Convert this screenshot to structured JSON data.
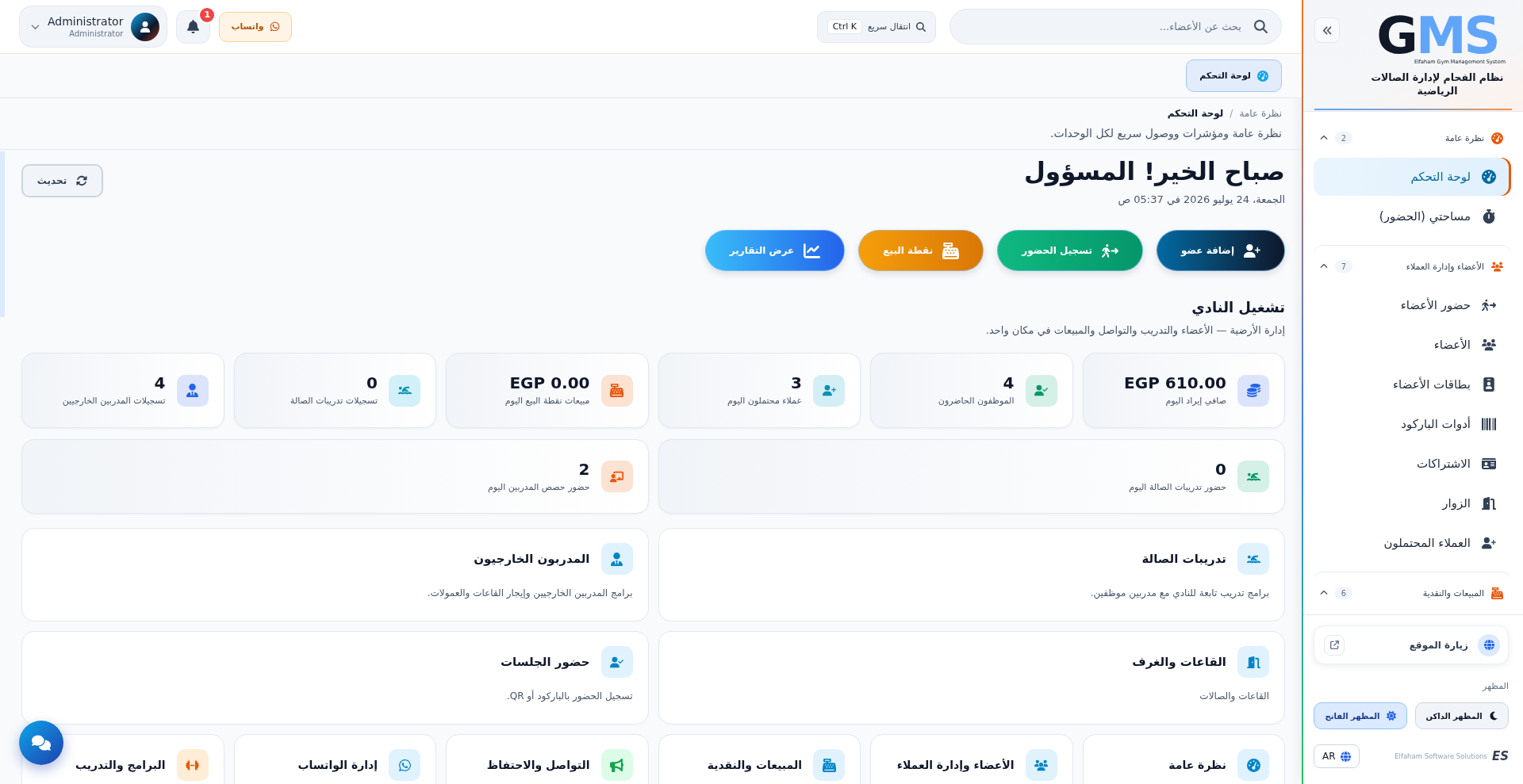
{
  "header": {
    "search": {
      "placeholder": "بحث عن الأعضاء..."
    },
    "quick_nav": {
      "label": "انتقال سريع",
      "shortcut": "Ctrl K"
    },
    "whatsapp": {
      "label": "واتساب"
    },
    "notifications": {
      "count": "1"
    },
    "user": {
      "name": "Administrator",
      "role": "Administrator"
    }
  },
  "tabs": [
    {
      "label": "لوحة التحكم",
      "selected": true
    }
  ],
  "breadcrumb": {
    "separator": "/",
    "items": [
      {
        "label": "نظرة عامة",
        "current": false
      },
      {
        "label": "لوحة التحكم",
        "current": true
      }
    ]
  },
  "page_description": "نظرة عامة ومؤشرات ووصول سريع لكل الوحدات.",
  "greeting": {
    "title": "صباح الخير! المسؤول",
    "date": "الجمعة، 24 يوليو 2026 في 05:37 ص",
    "refresh_button": "تحديث"
  },
  "quick_actions": [
    {
      "label": "إضافة عضو",
      "kind": "member"
    },
    {
      "label": "تسجيل الحضور",
      "kind": "attendance"
    },
    {
      "label": "نقطة البيع",
      "kind": "pos"
    },
    {
      "label": "عرض التقارير",
      "kind": "reports"
    }
  ],
  "section": {
    "title": "تشغيل النادي",
    "subtitle": "إدارة الأرضية — الأعضاء والتدريب والتواصل والمبيعات في مكان واحد."
  },
  "stats": [
    {
      "value": "EGP 610.00",
      "label": "صافي إيراد اليوم",
      "kind": "revenue"
    },
    {
      "value": "4",
      "label": "الموظفون الحاضرون",
      "kind": "staff"
    },
    {
      "value": "3",
      "label": "عملاء محتملون اليوم",
      "kind": "leads"
    },
    {
      "value": "EGP 0.00",
      "label": "مبيعات نقطة البيع اليوم",
      "kind": "pos"
    },
    {
      "value": "0",
      "label": "تسجيلات تدريبات الصالة",
      "kind": "gym"
    },
    {
      "value": "4",
      "label": "تسجيلات المدربين الخارجيين",
      "kind": "trainers"
    }
  ],
  "attendance_stats": [
    {
      "value": "0",
      "label": "حضور تدريبات الصالة اليوم",
      "kind": "gym"
    },
    {
      "value": "2",
      "label": "حضور حصص المدربين اليوم",
      "kind": "classes"
    }
  ],
  "modules": [
    {
      "title": "تدريبات الصالة",
      "description": "برامج تدريب تابعة للنادي مع مدربين موظفين.",
      "kind": "gym"
    },
    {
      "title": "المدربون الخارجيون",
      "description": "برامج المدربين الخارجيين وإيجار القاعات والعمولات.",
      "kind": "trainers"
    },
    {
      "title": "القاعات والغرف",
      "description": "القاعات والصالات",
      "kind": "rooms"
    },
    {
      "title": "حضور الجلسات",
      "description": "تسجيل الحضور بالباركود أو QR.",
      "kind": "sessions"
    }
  ],
  "hub_cards": [
    {
      "title": "نظرة عامة",
      "kind": "overview"
    },
    {
      "title": "الأعضاء وإدارة العملاء",
      "kind": "members"
    },
    {
      "title": "المبيعات والنقدية",
      "kind": "sales"
    },
    {
      "title": "التواصل والاحتفاظ",
      "kind": "retention"
    },
    {
      "title": "إدارة الواتساب",
      "kind": "whatsapp"
    },
    {
      "title": "البرامج والتدريب",
      "kind": "programs"
    }
  ],
  "sidebar": {
    "logo": {
      "primary": "G",
      "accent": "MS",
      "tagline": "Elfaham Gym Management System"
    },
    "title": "نظام الفحام لإدارة الصالات الرياضية",
    "groups": [
      {
        "label": "نظرة عامة",
        "count": "2",
        "expanded": true,
        "kind": "overview",
        "items": [
          {
            "label": "لوحة التحكم",
            "kind": "dashboard",
            "selected": true
          },
          {
            "label": "مساحتي (الحضور)",
            "kind": "myspace",
            "selected": false
          }
        ]
      },
      {
        "label": "الأعضاء وإدارة العملاء",
        "count": "7",
        "expanded": true,
        "kind": "members",
        "items": [
          {
            "label": "حضور الأعضاء",
            "kind": "attendance",
            "selected": false
          },
          {
            "label": "الأعضاء",
            "kind": "members",
            "selected": false
          },
          {
            "label": "بطاقات الأعضاء",
            "kind": "cards",
            "selected": false
          },
          {
            "label": "أدوات الباركود",
            "kind": "barcode",
            "selected": false
          },
          {
            "label": "الاشتراكات",
            "kind": "subscriptions",
            "selected": false
          },
          {
            "label": "الزوار",
            "kind": "visitors",
            "selected": false
          },
          {
            "label": "العملاء المحتملون",
            "kind": "leads",
            "selected": false
          }
        ]
      },
      {
        "label": "المبيعات والنقدية",
        "count": "6",
        "expanded": true,
        "kind": "sales"
      }
    ],
    "visit_site": {
      "label": "زيارة الموقع"
    },
    "appearance": {
      "label": "المظهر",
      "options": [
        {
          "label": "المظهر الداكن",
          "kind": "dark",
          "selected": false
        },
        {
          "label": "المظهر الفاتح",
          "kind": "light",
          "selected": true
        }
      ]
    },
    "language": {
      "label": "AR"
    },
    "footer": {
      "logo": "ES",
      "text": "Elfaham Software Solutions"
    }
  }
}
